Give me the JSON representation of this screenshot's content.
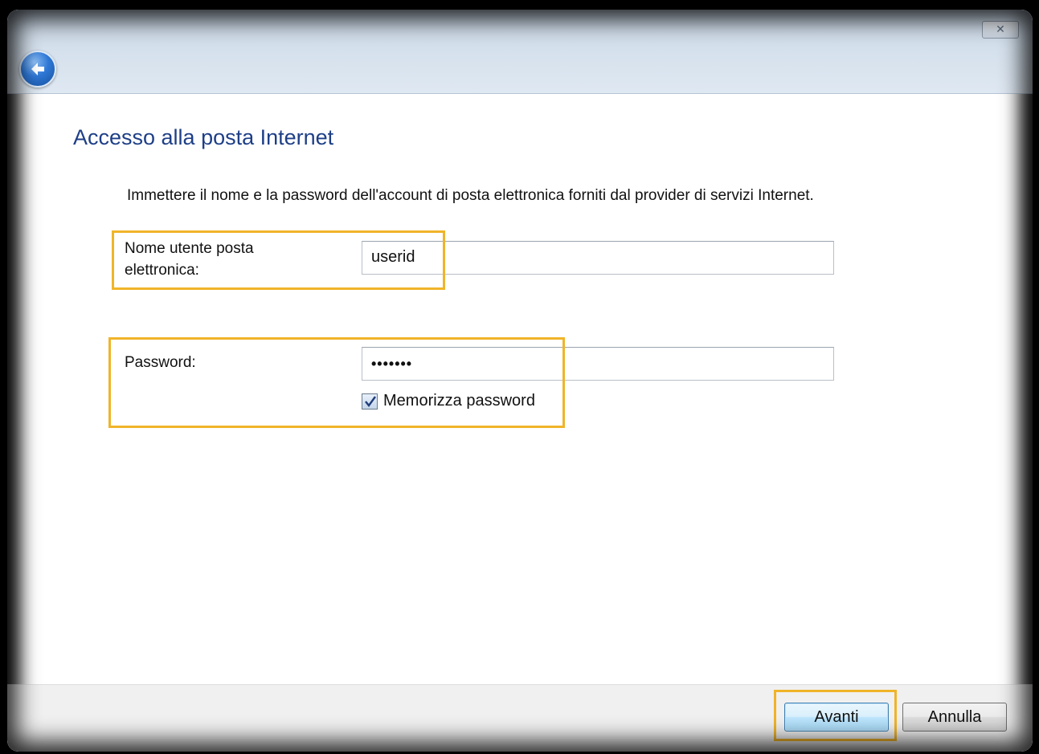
{
  "window": {
    "close_glyph": "✕"
  },
  "nav": {
    "back_icon": "back-arrow-icon"
  },
  "page": {
    "title": "Accesso alla posta Internet",
    "instructions": "Immettere il nome e la password dell'account di posta elettronica forniti dal provider di servizi Internet."
  },
  "form": {
    "username_label_line1": "Nome utente posta",
    "username_label_line2": "elettronica:",
    "username_value": "userid",
    "password_label": "Password:",
    "password_value": "•••••••",
    "remember_label": "Memorizza password",
    "remember_checked": true
  },
  "buttons": {
    "next": "Avanti",
    "cancel": "Annulla"
  },
  "colors": {
    "highlight": "#f0b429",
    "title": "#1e3f87"
  }
}
